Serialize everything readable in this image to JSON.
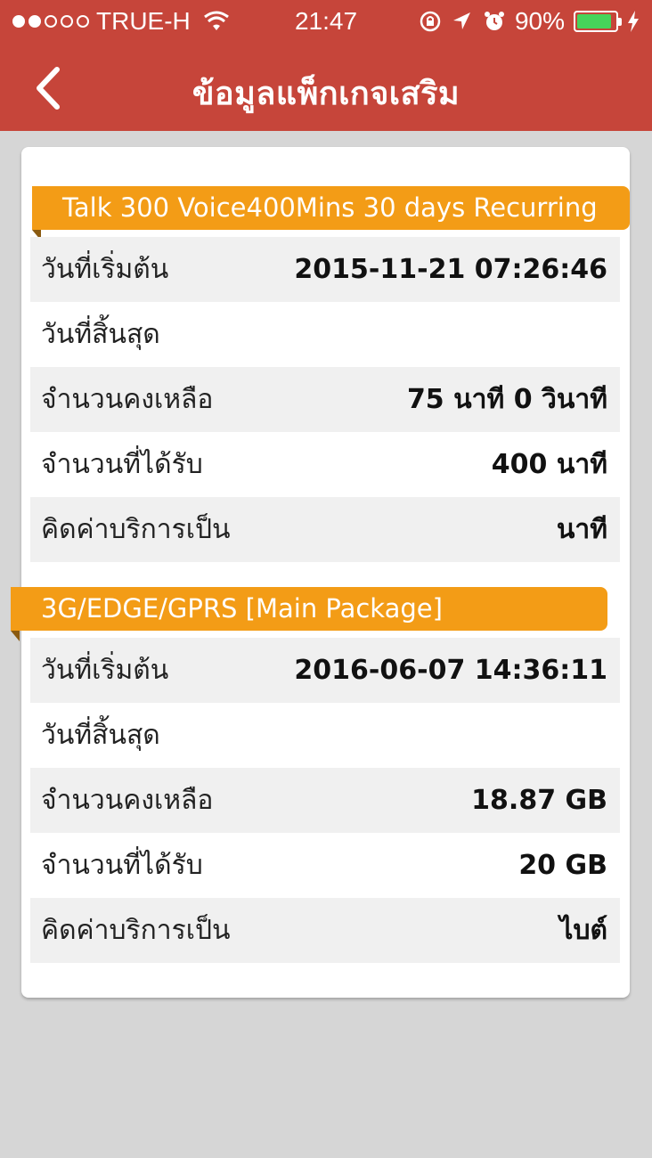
{
  "status_bar": {
    "carrier": "TRUE-H",
    "time": "21:47",
    "battery_percent": "90%",
    "battery_level": 0.9,
    "signal_filled": 2,
    "signal_total": 5
  },
  "nav": {
    "title": "ข้อมูลแพ็กเกจเสริม",
    "back_icon": "chevron-left-icon"
  },
  "colors": {
    "header": "#c6453a",
    "banner": "#f39c16",
    "background": "#d6d6d6",
    "battery": "#46d45a"
  },
  "packages": [
    {
      "name": "Talk 300 Voice400Mins 30 days Recurring",
      "rows": [
        {
          "label": "วันที่เริ่มต้น",
          "value": "2015-11-21 07:26:46"
        },
        {
          "label": "วันที่สิ้นสุด",
          "value": ""
        },
        {
          "label": "จำนวนคงเหลือ",
          "value": "75 นาที 0 วินาที"
        },
        {
          "label": "จำนวนที่ได้รับ",
          "value": "400 นาที"
        },
        {
          "label": "คิดค่าบริการเป็น",
          "value": "นาที"
        }
      ]
    },
    {
      "name": "3G/EDGE/GPRS [Main Package]",
      "rows": [
        {
          "label": "วันที่เริ่มต้น",
          "value": "2016-06-07 14:36:11"
        },
        {
          "label": "วันที่สิ้นสุด",
          "value": ""
        },
        {
          "label": "จำนวนคงเหลือ",
          "value": "18.87 GB"
        },
        {
          "label": "จำนวนที่ได้รับ",
          "value": "20 GB"
        },
        {
          "label": "คิดค่าบริการเป็น",
          "value": "ไบต์"
        }
      ]
    }
  ]
}
